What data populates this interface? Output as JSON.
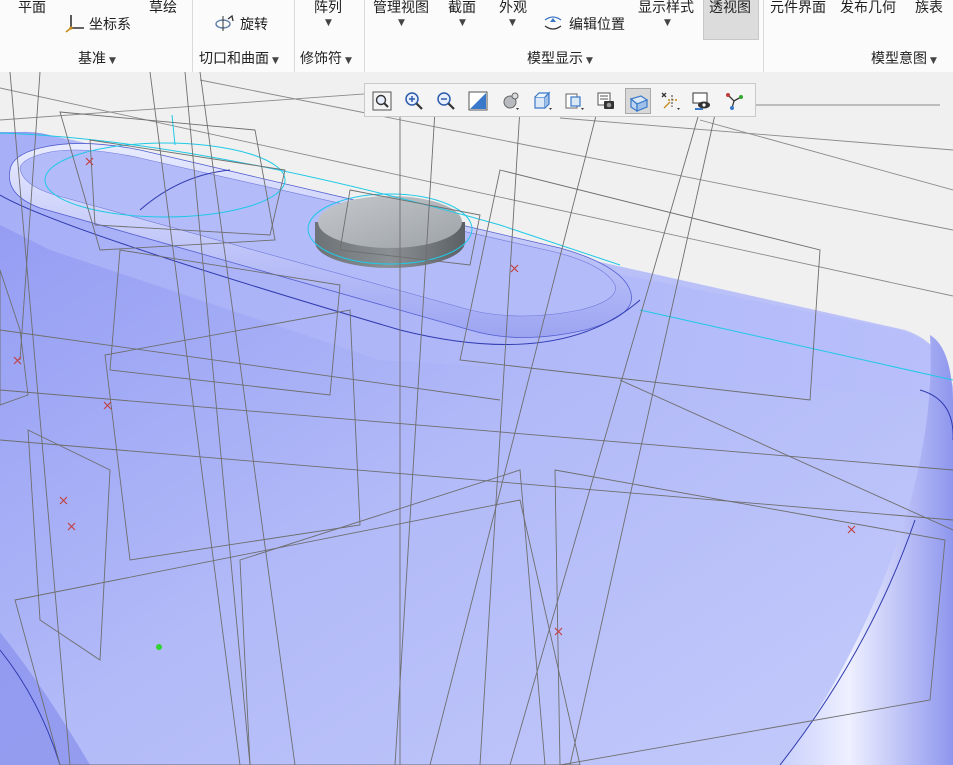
{
  "ribbon": {
    "cut_top": {
      "plane": "平面",
      "sketch": "草绘",
      "pattern": "阵列",
      "manage_views": "管理视图",
      "section": "截面",
      "appearance": "外观",
      "display_style": "显示样式",
      "perspective": "透视图",
      "component_interface": "元件界面",
      "publish_geometry": "发布几何",
      "family_table": "族表"
    },
    "buttons": {
      "coord_sys": "坐标系",
      "revolve": "旋转",
      "reorient": "编辑位置"
    },
    "groups": {
      "datum": "基准",
      "cuts_surfaces": "切口和曲面",
      "modifiers": "修饰符",
      "model_display": "模型显示",
      "model_intent": "模型意图"
    }
  },
  "graphics_toolbar": {
    "buttons": [
      {
        "icon": "refit-icon"
      },
      {
        "icon": "zoom-in-icon"
      },
      {
        "icon": "zoom-out-icon"
      },
      {
        "icon": "repaint-icon"
      },
      {
        "icon": "spin-center-icon"
      },
      {
        "icon": "view-manager-icon"
      },
      {
        "icon": "saved-orientations-icon"
      },
      {
        "icon": "appearance-gallery-icon"
      },
      {
        "icon": "display-style-icon"
      },
      {
        "icon": "datum-display-icon"
      },
      {
        "icon": "annotation-display-icon"
      },
      {
        "icon": "sketch-display-icon"
      }
    ],
    "active_index": 8
  },
  "colors": {
    "model_fill": "#a9b2f7",
    "model_edge": "#2f3bb0",
    "datum_line": "#7d7d7d",
    "sketch_cyan": "#1fc9e6",
    "datum_point": "#c43c3c"
  }
}
